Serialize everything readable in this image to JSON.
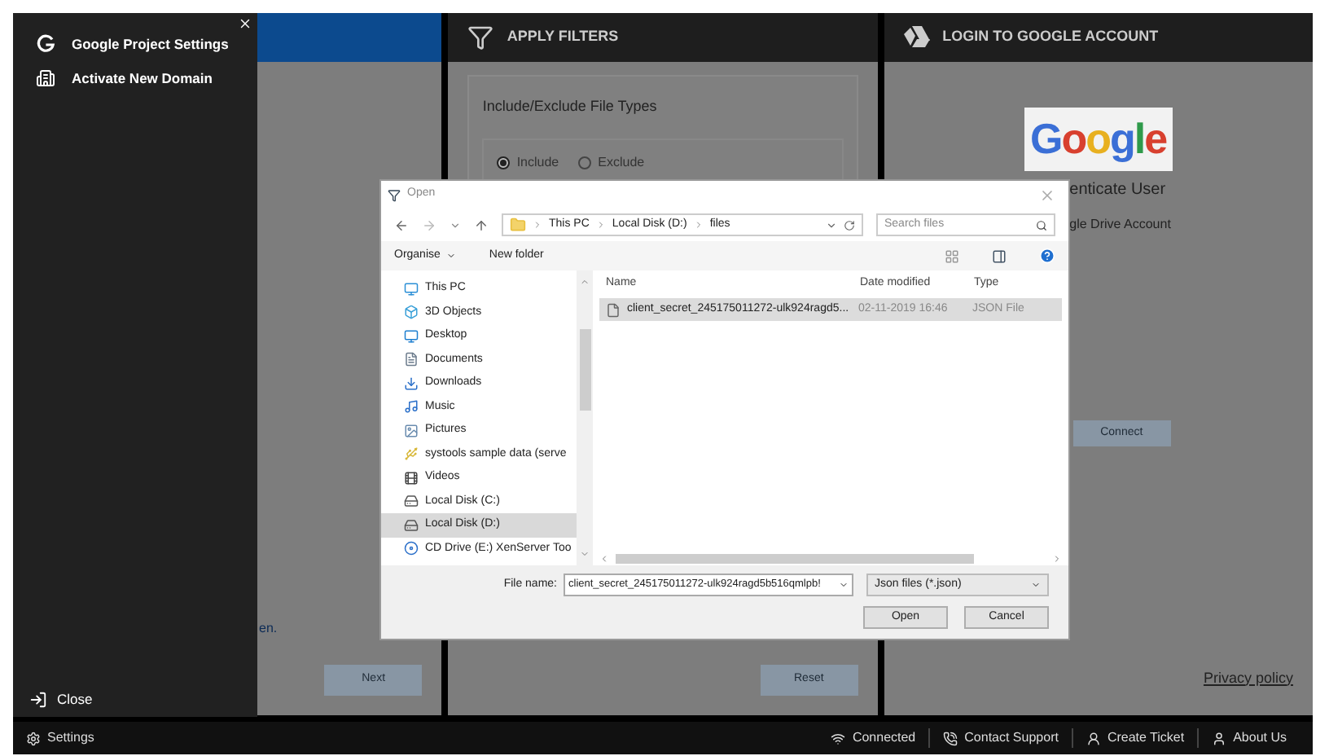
{
  "sidebar": {
    "items": [
      {
        "label": "Google Project Settings",
        "kind": "google"
      },
      {
        "label": "Activate New Domain",
        "kind": "building"
      }
    ],
    "close": "Close"
  },
  "panels": [
    {
      "kind": "plain",
      "link": "en.",
      "button": "Next"
    },
    {
      "kind": "filters",
      "title": "APPLY FILTERS",
      "card_title": "Include/Exclude File Types",
      "options": [
        {
          "label": "Include",
          "selected": true
        },
        {
          "label": "Exclude",
          "selected": false
        }
      ],
      "button": "Reset"
    },
    {
      "kind": "login",
      "title": "LOGIN TO GOOGLE ACCOUNT",
      "logo": "Google",
      "heading": "enticate User",
      "subtitle": "gle Drive Account",
      "button": "Connect",
      "link": "Privacy policy"
    }
  ],
  "dialog": {
    "title": "Open",
    "path": [
      "This PC",
      "Local Disk (D:)",
      "files"
    ],
    "search_placeholder": "Search files",
    "toolbar": [
      "Organise",
      "New folder"
    ],
    "tree": [
      {
        "label": "This PC",
        "kind": "pc",
        "selected": false
      },
      {
        "label": "3D Objects",
        "kind": "cube",
        "selected": false
      },
      {
        "label": "Desktop",
        "kind": "desktop",
        "selected": false
      },
      {
        "label": "Documents",
        "kind": "doc",
        "selected": false
      },
      {
        "label": "Downloads",
        "kind": "download",
        "selected": false
      },
      {
        "label": "Music",
        "kind": "music",
        "selected": false
      },
      {
        "label": "Pictures",
        "kind": "picture",
        "selected": false
      },
      {
        "label": "systools sample data (serve",
        "kind": "usb",
        "selected": false
      },
      {
        "label": "Videos",
        "kind": "video",
        "selected": false
      },
      {
        "label": "Local Disk (C:)",
        "kind": "disk",
        "selected": false
      },
      {
        "label": "Local Disk (D:)",
        "kind": "disk",
        "selected": true
      },
      {
        "label": "CD Drive (E:) XenServer Too",
        "kind": "cd",
        "selected": false
      }
    ],
    "columns": [
      "Name",
      "Date modified",
      "Type"
    ],
    "files": [
      {
        "name": "client_secret_245175011272-ulk924ragd5...",
        "date": "02-11-2019 16:46",
        "type": "JSON File",
        "selected": true
      }
    ],
    "file_name_label": "File name:",
    "file_name": "client_secret_245175011272-ulk924ragd5b516qmlpb!",
    "filter": "Json files (*.json)",
    "buttons": [
      "Open",
      "Cancel"
    ]
  },
  "status_bar": {
    "settings": "Settings",
    "items": [
      {
        "label": "Connected",
        "kind": "wifi"
      },
      {
        "label": "Contact Support",
        "kind": "phone"
      },
      {
        "label": "Create Ticket",
        "kind": "ticket"
      },
      {
        "label": "About Us",
        "kind": "user"
      }
    ]
  }
}
